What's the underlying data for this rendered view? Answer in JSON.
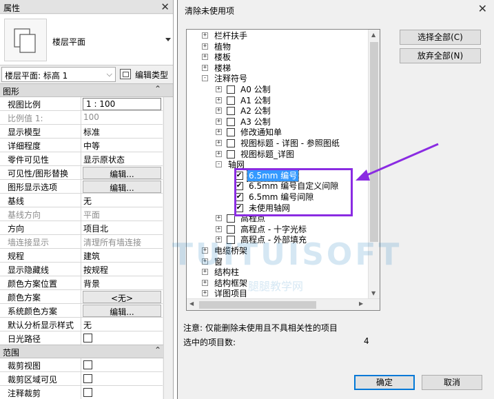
{
  "properties": {
    "title": "属性",
    "type_name": "楼层平面",
    "type_selector": "楼层平面: 标高 1",
    "edit_type_label": "编辑类型",
    "section_graphics": "图形",
    "section_extents": "范围",
    "rows": [
      {
        "key": "视图比例",
        "value": "1 : 100",
        "style": "boxed"
      },
      {
        "key": "比例值 1:",
        "value": "100",
        "style": "disabled"
      },
      {
        "key": "显示模型",
        "value": "标准"
      },
      {
        "key": "详细程度",
        "value": "中等"
      },
      {
        "key": "零件可见性",
        "value": "显示原状态"
      },
      {
        "key": "可见性/图形替换",
        "value": "编辑...",
        "style": "button"
      },
      {
        "key": "图形显示选项",
        "value": "编辑...",
        "style": "button"
      },
      {
        "key": "基线",
        "value": "无"
      },
      {
        "key": "基线方向",
        "value": "平面",
        "style": "disabled"
      },
      {
        "key": "方向",
        "value": "项目北"
      },
      {
        "key": "墙连接显示",
        "value": "清理所有墙连接",
        "style": "disabled"
      },
      {
        "key": "规程",
        "value": "建筑"
      },
      {
        "key": "显示隐藏线",
        "value": "按规程"
      },
      {
        "key": "颜色方案位置",
        "value": "背景"
      },
      {
        "key": "颜色方案",
        "value": "<无>",
        "style": "button"
      },
      {
        "key": "系统颜色方案",
        "value": "编辑...",
        "style": "button"
      },
      {
        "key": "默认分析显示样式",
        "value": "无"
      },
      {
        "key": "日光路径",
        "value": "",
        "style": "checkbox"
      }
    ],
    "rows2": [
      {
        "key": "裁剪视图",
        "value": "",
        "style": "checkbox"
      },
      {
        "key": "裁剪区域可见",
        "value": "",
        "style": "checkbox"
      },
      {
        "key": "注释裁剪",
        "value": "",
        "style": "checkbox"
      }
    ]
  },
  "dialog": {
    "title": "清除未使用项",
    "select_all": "选择全部(C)",
    "deselect_all": "放弃全部(N)",
    "note": "注意: 仅能删除未使用且不具相关性的项目",
    "selected_count_label": "选中的项目数:",
    "selected_count": "4",
    "ok": "确定",
    "cancel": "取消",
    "tree": [
      {
        "level": 1,
        "exp": "+",
        "cb": "none",
        "label": "栏杆扶手"
      },
      {
        "level": 1,
        "exp": "+",
        "cb": "none",
        "label": "植物"
      },
      {
        "level": 1,
        "exp": "+",
        "cb": "none",
        "label": "楼板"
      },
      {
        "level": 1,
        "exp": "+",
        "cb": "none",
        "label": "楼梯"
      },
      {
        "level": 1,
        "exp": "-",
        "cb": "none",
        "label": "注释符号"
      },
      {
        "level": 2,
        "exp": "+",
        "cb": "off",
        "label": "A0 公制"
      },
      {
        "level": 2,
        "exp": "+",
        "cb": "off",
        "label": "A1 公制"
      },
      {
        "level": 2,
        "exp": "+",
        "cb": "off",
        "label": "A2 公制"
      },
      {
        "level": 2,
        "exp": "+",
        "cb": "off",
        "label": "A3 公制"
      },
      {
        "level": 2,
        "exp": "+",
        "cb": "off",
        "label": "修改通知单"
      },
      {
        "level": 2,
        "exp": "+",
        "cb": "off",
        "label": "视图标题 - 详图 - 参照图纸"
      },
      {
        "level": 2,
        "exp": "+",
        "cb": "off",
        "label": "视图标题_详图"
      },
      {
        "level": 2,
        "exp": "-",
        "cb": "none",
        "label": "轴网"
      },
      {
        "level": 3,
        "exp": "",
        "cb": "on",
        "label": "6.5mm 编号",
        "selected": true
      },
      {
        "level": 3,
        "exp": "",
        "cb": "on",
        "label": "6.5mm 编号自定义间隙"
      },
      {
        "level": 3,
        "exp": "",
        "cb": "on",
        "label": "6.5mm 编号间隙"
      },
      {
        "level": 3,
        "exp": "",
        "cb": "on",
        "label": "未使用轴网"
      },
      {
        "level": 2,
        "exp": "+",
        "cb": "off",
        "label": "高程点"
      },
      {
        "level": 2,
        "exp": "+",
        "cb": "off",
        "label": "高程点 - 十字光标"
      },
      {
        "level": 2,
        "exp": "+",
        "cb": "off",
        "label": "高程点 - 外部填充"
      },
      {
        "level": 1,
        "exp": "+",
        "cb": "none",
        "label": "电缆桥架"
      },
      {
        "level": 1,
        "exp": "+",
        "cb": "none",
        "label": "窗"
      },
      {
        "level": 1,
        "exp": "+",
        "cb": "none",
        "label": "结构柱"
      },
      {
        "level": 1,
        "exp": "+",
        "cb": "none",
        "label": "结构框架"
      },
      {
        "level": 1,
        "exp": "+",
        "cb": "none",
        "label": "详图项目"
      }
    ]
  },
  "watermark": {
    "brand": "TUITUISOFT",
    "sub": "腿腿教学网"
  },
  "colors": {
    "highlight": "#8a2be2",
    "selection": "#3399ff",
    "default_button_border": "#0078d7"
  }
}
